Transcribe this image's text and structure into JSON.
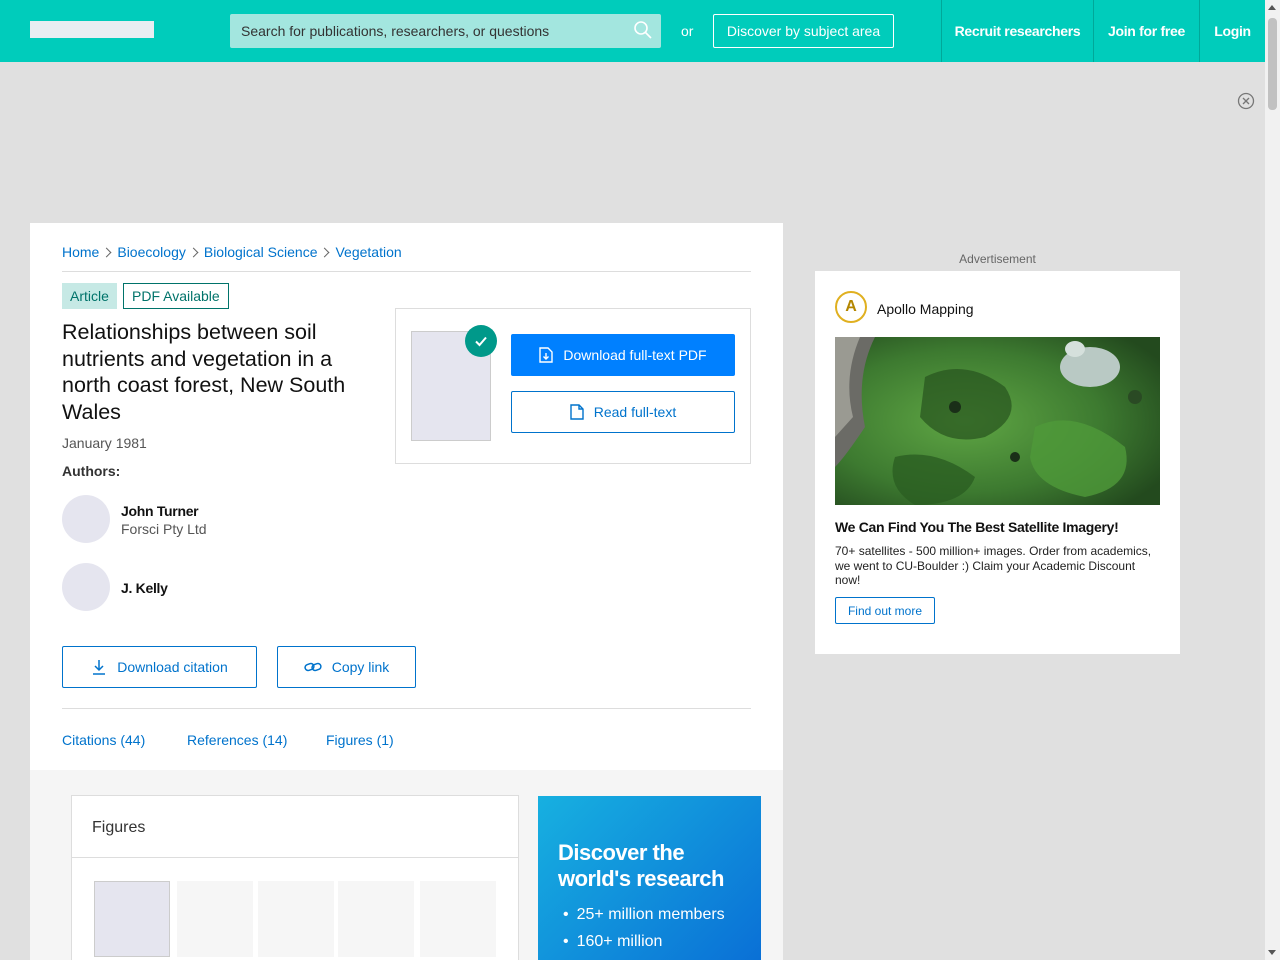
{
  "header": {
    "search_placeholder": "Search for publications, researchers, or questions",
    "or_label": "or",
    "discover_label": "Discover by subject area",
    "nav": [
      "Recruit researchers",
      "Join for free",
      "Login"
    ]
  },
  "breadcrumb": [
    "Home",
    "Bioecology",
    "Biological Science",
    "Vegetation"
  ],
  "tags": {
    "article": "Article",
    "pdf": "PDF Available"
  },
  "publication": {
    "title": "Relationships between soil nutrients and vegetation in a north coast forest, New South Wales",
    "date": "January 1981",
    "authors_label": "Authors:",
    "authors": [
      {
        "name": "John Turner",
        "affiliation": "Forsci Pty Ltd"
      },
      {
        "name": "J. Kelly",
        "affiliation": ""
      }
    ]
  },
  "actions": {
    "download_pdf": "Download full-text PDF",
    "read_fulltext": "Read full-text",
    "download_citation": "Download citation",
    "copy_link": "Copy link"
  },
  "tabs": [
    "Citations (44)",
    "References (14)",
    "Figures (1)"
  ],
  "figures": {
    "title": "Figures"
  },
  "promo": {
    "title": "Discover the world's research",
    "bullets": [
      "25+ million members",
      "160+ million"
    ]
  },
  "ad": {
    "label": "Advertisement",
    "brand": "Apollo Mapping",
    "logo_letter": "A",
    "headline": "We Can Find You The Best Satellite Imagery!",
    "body": "70+ satellites - 500 million+ images. Order from academics, we went to CU-Boulder :) Claim your Academic Discount now!",
    "cta": "Find out more"
  },
  "colors": {
    "brand": "#00ccbb",
    "link": "#0073cc",
    "primary": "#0080ff",
    "badge": "#00998a"
  }
}
